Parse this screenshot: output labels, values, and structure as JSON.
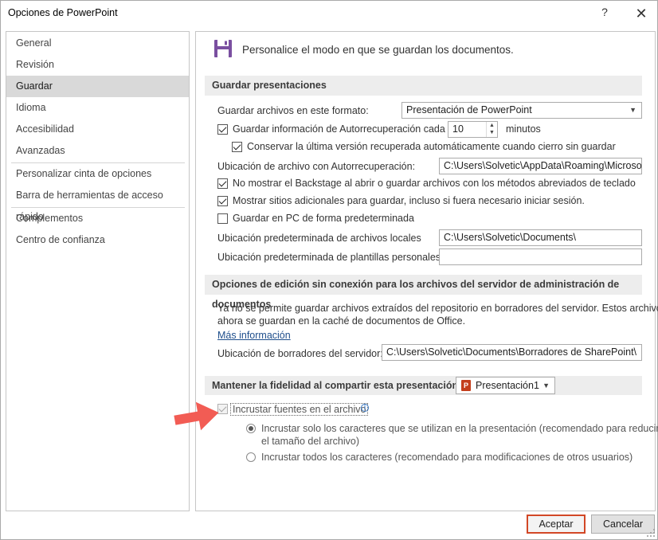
{
  "window": {
    "title": "Opciones de PowerPoint",
    "help_label": "?",
    "close_label": "✕"
  },
  "nav": {
    "items": [
      {
        "label": "General"
      },
      {
        "label": "Revisión"
      },
      {
        "label": "Guardar",
        "selected": true
      },
      {
        "label": "Idioma"
      },
      {
        "label": "Accesibilidad"
      },
      {
        "label": "Avanzadas"
      },
      {
        "label": "Personalizar cinta de opciones"
      },
      {
        "label": "Barra de herramientas de acceso rápido"
      },
      {
        "label": "Complementos"
      },
      {
        "label": "Centro de confianza"
      }
    ]
  },
  "header": {
    "text": "Personalice el modo en que se guardan los documentos.",
    "icon": "floppy-disk-icon",
    "icon_color": "#7a4fa0"
  },
  "save_presentations": {
    "section_title": "Guardar presentaciones",
    "format_label": "Guardar archivos en este formato:",
    "format_value": "Presentación de PowerPoint",
    "autorecover_label": "Guardar información de Autorrecuperación cada",
    "autorecover_checked": true,
    "autorecover_minutes": "10",
    "minutes_label": "minutos",
    "keep_last_label": "Conservar la última versión recuperada automáticamente cuando cierro sin guardar",
    "keep_last_checked": true,
    "autorecover_location_label": "Ubicación de archivo con Autorrecuperación:",
    "autorecover_location_value": "C:\\Users\\Solvetic\\AppData\\Roaming\\Microsoft\\",
    "no_backstage_label": "No mostrar el Backstage al abrir o guardar archivos con los métodos abreviados de teclado",
    "no_backstage_checked": true,
    "show_additional_label": "Mostrar sitios adicionales para guardar, incluso si fuera necesario iniciar sesión.",
    "show_additional_checked": true,
    "save_to_pc_label": "Guardar en PC de forma predeterminada",
    "save_to_pc_checked": false,
    "local_files_label": "Ubicación predeterminada de archivos locales",
    "local_files_value": "C:\\Users\\Solvetic\\Documents\\",
    "templates_label": "Ubicación predeterminada de plantillas personales:",
    "templates_value": ""
  },
  "offline_editing": {
    "section_title": "Opciones de edición sin conexión para los archivos del servidor de administración de documentos",
    "description_line1": "Ya no se permite guardar archivos extraídos del repositorio en borradores del servidor. Estos archivos",
    "description_line2": "ahora se guardan en la caché de documentos de Office.",
    "more_info_label": "Más información",
    "drafts_label": "Ubicación de borradores del servidor:",
    "drafts_value": "C:\\Users\\Solvetic\\Documents\\Borradores de SharePoint\\"
  },
  "fidelity": {
    "section_title": "Mantener la fidelidad al compartir esta presentación:",
    "presentation_value": "Presentación1",
    "embed_fonts_label": "Incrustar fuentes en el archivo",
    "embed_fonts_checked": true,
    "option_only_used_line1": "Incrustar solo los caracteres que se utilizan  en la presentación (recomendado para reducir",
    "option_only_used_line2": "el tamaño del archivo)",
    "option_only_used_selected": true,
    "option_all_label": "Incrustar todos los caracteres (recomendado para modificaciones de otros usuarios)",
    "option_all_selected": false
  },
  "footer": {
    "ok_label": "Aceptar",
    "cancel_label": "Cancelar"
  },
  "colors": {
    "accent_border": "#d24726",
    "annotation_arrow": "#f25c54",
    "nav_selected": "#d9d9d9"
  }
}
